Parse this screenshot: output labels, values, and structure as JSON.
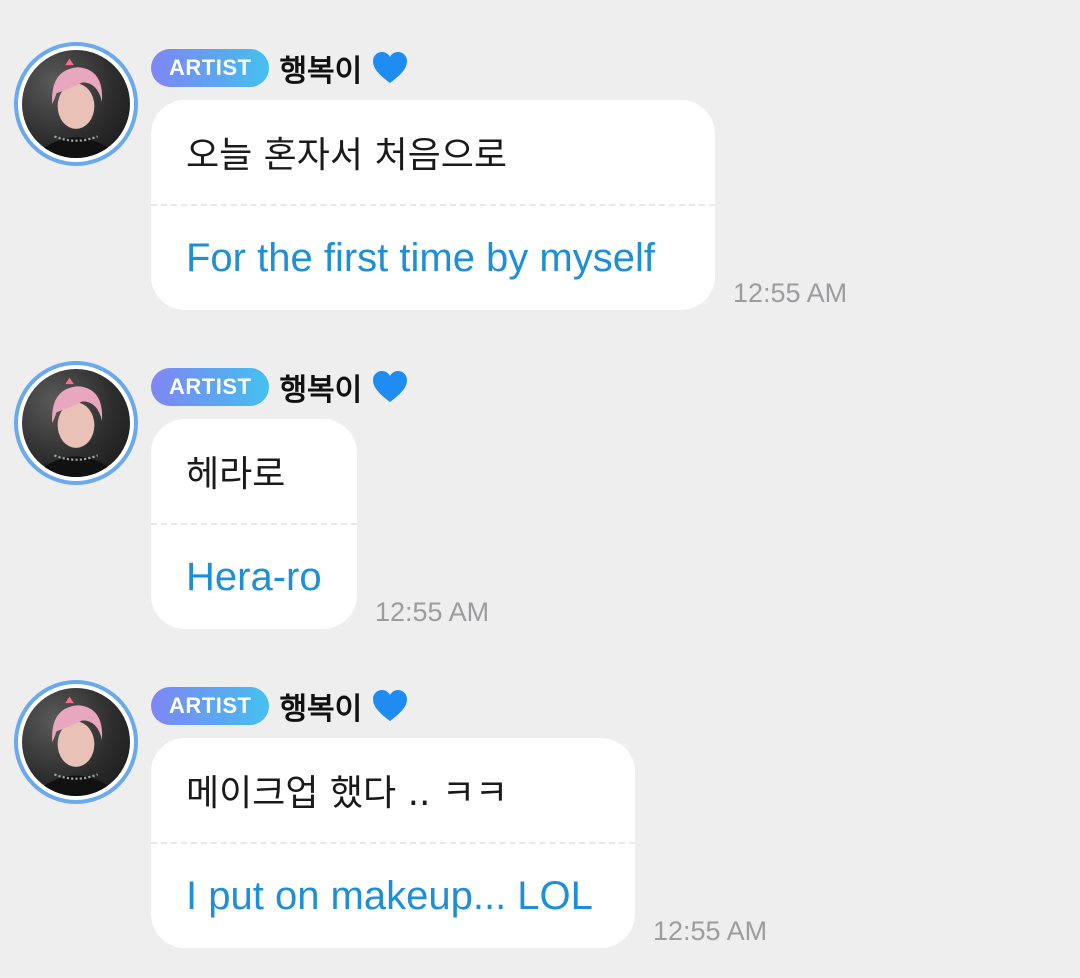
{
  "messages": [
    {
      "badge": "ARTIST",
      "name": "행복이",
      "original": "오늘 혼자서 처음으로",
      "translation": "For the first time by myself",
      "time": "12:55 AM"
    },
    {
      "badge": "ARTIST",
      "name": "행복이",
      "original": "헤라로",
      "translation": "Hera-ro",
      "time": "12:55 AM"
    },
    {
      "badge": "ARTIST",
      "name": "행복이",
      "original": "메이크업 했다 .. ㅋㅋ",
      "translation": "I put on makeup... LOL",
      "time": "12:55 AM"
    }
  ],
  "icons": {
    "heart": "blue-heart-icon",
    "avatar": "profile-photo"
  },
  "colors": {
    "background": "#eeeeef",
    "badge_gradient_start": "#7f86f4",
    "badge_gradient_end": "#45c0ef",
    "translation_text": "#1d8fd8",
    "heart": "#1e8cf0",
    "avatar_ring": "#6aa9ee",
    "timestamp": "#9c9c9e"
  }
}
